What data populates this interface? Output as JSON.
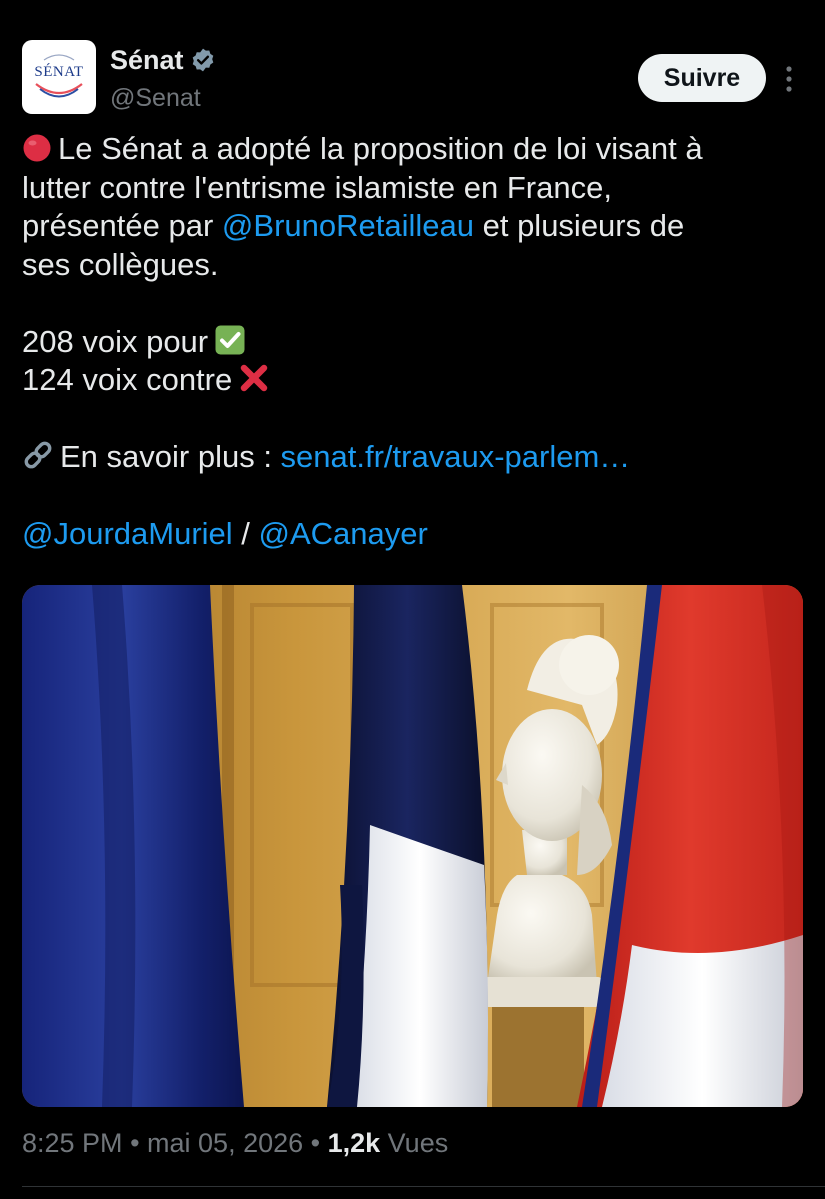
{
  "account": {
    "display_name": "Sénat",
    "handle": "@Senat",
    "avatar_text": "SÉNAT",
    "verified": true
  },
  "actions": {
    "follow_label": "Suivre",
    "more_icon": "more-vertical-icon"
  },
  "post": {
    "line1_text": "Le Sénat a adopté la proposition de loi visant à",
    "line2_text": "lutter contre l'entrisme islamiste en France,",
    "line3_prefix": "présentée par ",
    "line3_mention": "@BrunoRetailleau",
    "line3_suffix": " et plusieurs de",
    "line4_text": "ses collègues.",
    "votes_for": "208 voix pour",
    "votes_against": "124 voix contre",
    "learn_more_label": "En savoir plus : ",
    "learn_more_link": "senat.fr/travaux-parlem…",
    "mention_1": "@JourdaMuriel",
    "mention_separator": " / ",
    "mention_2": "@ACanayer"
  },
  "meta": {
    "time": "8:25 PM",
    "separator": " • ",
    "date": "mai 05, 2026",
    "views_count": "1,2k",
    "views_label": " Vues"
  },
  "colors": {
    "background": "#000000",
    "text": "#e7e9ea",
    "secondary": "#71767b",
    "link": "#1d9bf0",
    "verified": "#829aab",
    "flag_blue": "#1d2f8a",
    "flag_red": "#d42a20"
  }
}
